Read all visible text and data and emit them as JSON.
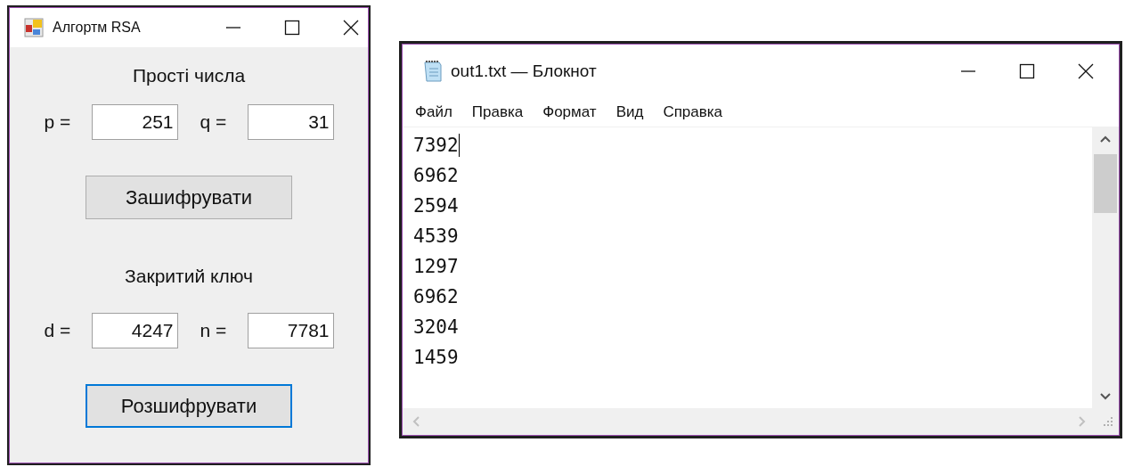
{
  "rsa_window": {
    "title": "Алгортм RSA",
    "primes_heading": "Прості числа",
    "primes_fields": [
      {
        "label": "p =",
        "value": "251"
      },
      {
        "label": "q =",
        "value": "31"
      }
    ],
    "encrypt_button": {
      "label": "Зашифрувати",
      "focused": false
    },
    "key_heading": "Закритий ключ",
    "key_fields": [
      {
        "label": "d =",
        "value": "4247"
      },
      {
        "label": "n =",
        "value": "7781"
      }
    ],
    "decrypt_button": {
      "label": "Розшифрувати",
      "focused": true
    }
  },
  "notepad_window": {
    "title": "out1.txt — Блокнот",
    "menu": [
      "Файл",
      "Правка",
      "Формат",
      "Вид",
      "Справка"
    ],
    "lines": [
      {
        "text": "7392",
        "caret": true
      },
      {
        "text": "6962",
        "caret": false
      },
      {
        "text": "2594",
        "caret": false
      },
      {
        "text": "4539",
        "caret": false
      },
      {
        "text": "1297",
        "caret": false
      },
      {
        "text": "6962",
        "caret": false
      },
      {
        "text": "3204",
        "caret": false
      },
      {
        "text": "1459",
        "caret": false
      }
    ]
  }
}
